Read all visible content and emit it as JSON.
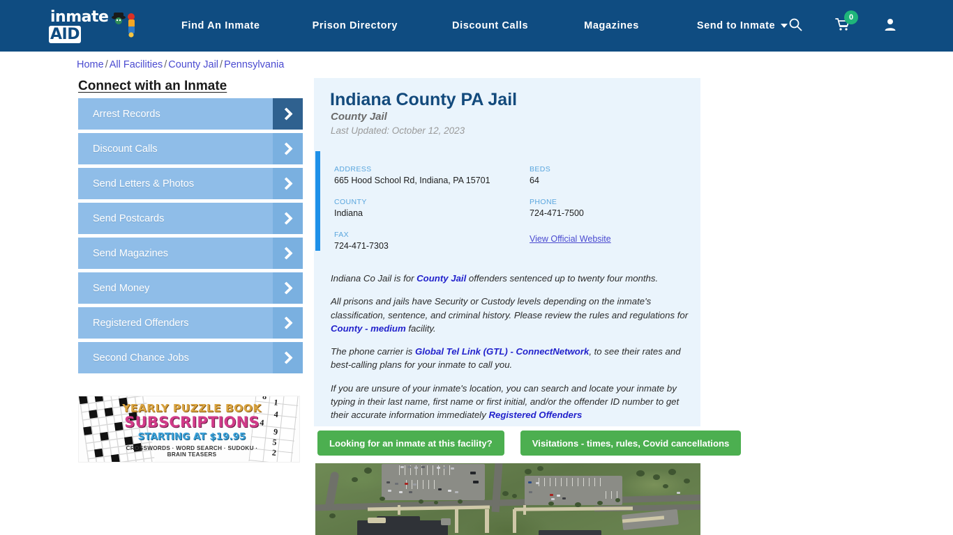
{
  "header": {
    "logo_text": "inmate",
    "logo_accent": "AID",
    "logo_icon": "inmate-character-icon",
    "nav": [
      {
        "label": "Find An Inmate"
      },
      {
        "label": "Prison Directory"
      },
      {
        "label": "Discount Calls"
      },
      {
        "label": "Magazines"
      },
      {
        "label": "Send to Inmate",
        "has_caret": true
      }
    ],
    "icons": {
      "search": "search-icon",
      "cart": "shopping-cart-icon",
      "cart_count": "0",
      "account": "user-account-icon"
    },
    "bg_color": "#0f4c81"
  },
  "breadcrumb": {
    "items": [
      "Home",
      "All Facilities",
      "County Jail",
      "Pennsylvania"
    ],
    "separator": "/"
  },
  "sidebar": {
    "title": "Connect with an Inmate",
    "items": [
      {
        "label": "Arrest Records",
        "active": true
      },
      {
        "label": "Discount Calls",
        "active": false
      },
      {
        "label": "Send Letters & Photos",
        "active": false
      },
      {
        "label": "Send Postcards",
        "active": false
      },
      {
        "label": "Send Magazines",
        "active": false
      },
      {
        "label": "Send Money",
        "active": false
      },
      {
        "label": "Registered Offenders",
        "active": false
      },
      {
        "label": "Second Chance Jobs",
        "active": false
      }
    ],
    "ad": {
      "line1": "YEARLY PUZZLE BOOK",
      "line2": "SUBSCRIPTIONS",
      "line3": "STARTING AT $19.95",
      "line4": "CROSSWORDS · WORD SEARCH · SUDOKU · BRAIN TEASERS",
      "sudoku_numbers": [
        "8",
        "1",
        "4",
        "4",
        "9",
        "5",
        "2"
      ]
    }
  },
  "facility": {
    "title": "Indiana County PA Jail",
    "subtitle": "County Jail",
    "last_updated": "Last Updated: October 12, 2023",
    "fields": [
      {
        "label": "ADDRESS",
        "value": "665 Hood School Rd, Indiana, PA 15701"
      },
      {
        "label": "BEDS",
        "value": "64"
      },
      {
        "label": "COUNTY",
        "value": "Indiana"
      },
      {
        "label": "PHONE",
        "value": "724-471-7500"
      },
      {
        "label": "FAX",
        "value": "724-471-7303"
      },
      {
        "label": "",
        "value": "",
        "link": "View Official Website"
      }
    ],
    "paragraphs": {
      "p1_a": "Indiana Co Jail is for ",
      "p1_link": "County Jail",
      "p1_b": " offenders sentenced up to twenty four months.",
      "p2_a": "All prisons and jails have Security or Custody levels depending on the inmate's classification, sentence, and criminal history. Please review the rules and regulations for ",
      "p2_link": "County - medium",
      "p2_b": " facility.",
      "p3_a": "The phone carrier is ",
      "p3_link": "Global Tel Link (GTL) - ConnectNetwork",
      "p3_b": ", to see their rates and best-calling plans for your inmate to call you.",
      "p4_a": "If you are unsure of your inmate's location, you can search and locate your inmate by typing in their last name, first name or first initial, and/or the offender ID number to get their accurate information immediately ",
      "p4_link": "Registered Offenders"
    }
  },
  "actions": {
    "inmate_search_label": "Looking for an inmate at this facility?",
    "visitation_label": "Visitations - times, rules, Covid cancellations",
    "button_color": "#4caf50"
  },
  "media": {
    "aerial_photo_alt": "Aerial satellite view of Indiana County PA Jail facility parking lots and buildings"
  },
  "colors": {
    "nav_bg": "#0f4c81",
    "panel_bg": "#eaf4fc",
    "accent_bar": "#1e90e8",
    "sidebar_btn": "#8fbde8",
    "sidebar_btn_active_chevron": "#2f618f",
    "link": "#2222cc",
    "badge_green": "#1fb57a"
  }
}
